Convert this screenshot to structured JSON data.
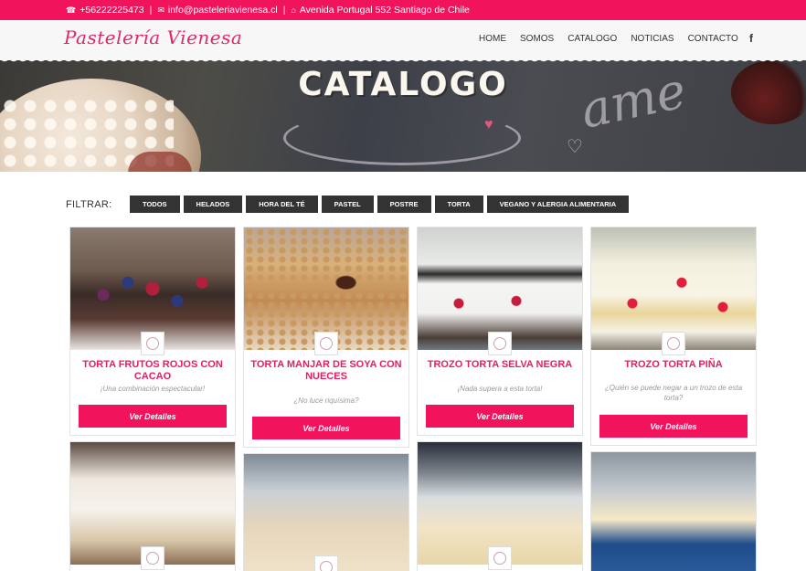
{
  "topbar": {
    "phone": "+56222225473",
    "email": "info@pasteleriavienesa.cl",
    "address": "Avenida Portugal 552 Santiago de Chile"
  },
  "header": {
    "logo": "Pastelería Vienesa",
    "nav": [
      "HOME",
      "SOMOS",
      "CATALOGO",
      "NOTICIAS",
      "CONTACTO"
    ],
    "social": "f"
  },
  "banner": {
    "title": "CATALOGO"
  },
  "filter": {
    "label": "FILTRAR:",
    "options": [
      "TODOS",
      "HELADOS",
      "HORA DEL TÉ",
      "PASTEL",
      "POSTRE",
      "TORTA",
      "VEGANO Y ALERGIA ALIMENTARIA"
    ]
  },
  "products": [
    {
      "title": "TORTA FRUTOS ROJOS CON CACAO",
      "description": "¡Una combinación espectacular!",
      "button": "Ver Detalles"
    },
    {
      "title": "TORTA MANJAR DE SOYA CON NUECES",
      "description": "¿No luce riquísima?",
      "button": "Ver Detalles"
    },
    {
      "title": "TROZO TORTA SELVA NEGRA",
      "description": "¡Nada supera a esta torta!",
      "button": "Ver Detalles"
    },
    {
      "title": "TROZO TORTA PIÑA",
      "description": "¿Quién se puede negar a un trozo de esta torta?",
      "button": "Ver Detalles"
    }
  ],
  "icons": {
    "phone": "phone-icon",
    "email": "envelope-icon",
    "address": "home-icon",
    "social": "facebook-icon"
  },
  "colors": {
    "accent": "#f2135d",
    "filter_bg": "#333333",
    "title_pink": "#e81c64"
  }
}
